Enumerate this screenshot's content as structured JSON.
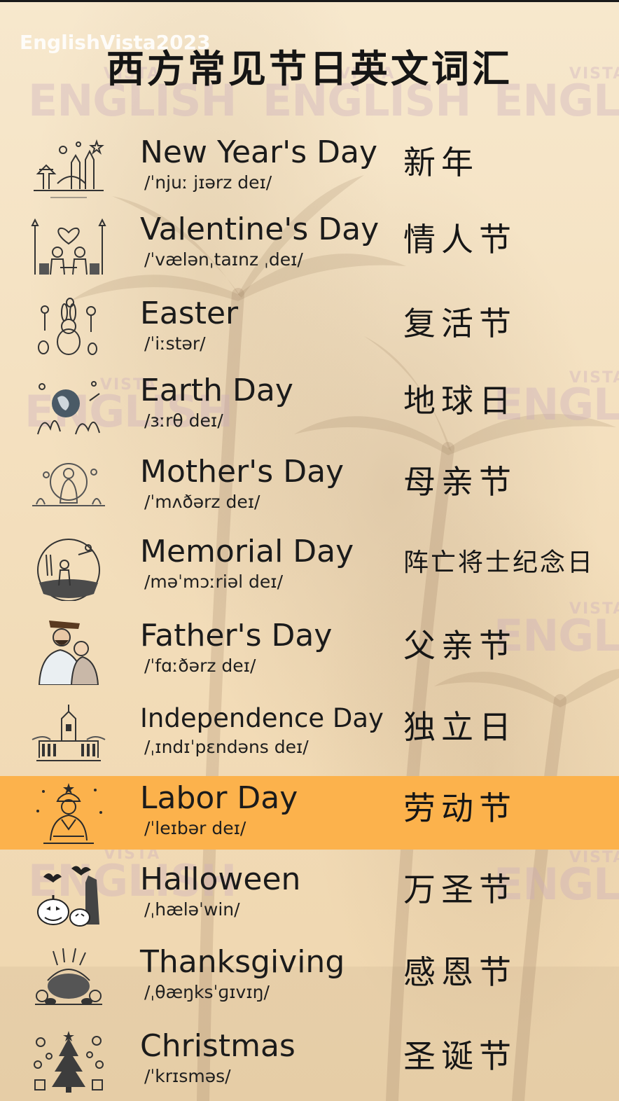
{
  "channel": "EnglishVista2023",
  "title": "西方常见节日英文词汇",
  "watermark": {
    "line1": "VISTA",
    "line2": "ENGLISH"
  },
  "highlight_color": "#fcb24c",
  "items": [
    {
      "icon": "new-year-icon",
      "english": "New Year's Day",
      "ipa": "/ˈnjuː jɪərz deɪ/",
      "chinese": "新年"
    },
    {
      "icon": "valentine-icon",
      "english": "Valentine's Day",
      "ipa": "/ˈvælənˌtaɪnz ˌdeɪ/",
      "chinese": "情人节"
    },
    {
      "icon": "easter-bunny-icon",
      "english": "Easter",
      "ipa": "/ˈiːstər/",
      "chinese": "复活节"
    },
    {
      "icon": "earth-globe-icon",
      "english": "Earth Day",
      "ipa": "/ɜːrθ deɪ/",
      "chinese": "地球日"
    },
    {
      "icon": "mother-child-icon",
      "english": "Mother's Day",
      "ipa": "/ˈmʌðərz deɪ/",
      "chinese": "母亲节"
    },
    {
      "icon": "memorial-soldier-icon",
      "english": "Memorial Day",
      "ipa": "/məˈmɔːriəl deɪ/",
      "chinese": "阵亡将士纪念日"
    },
    {
      "icon": "father-child-icon",
      "english": "Father's Day",
      "ipa": "/ˈfɑːðərz deɪ/",
      "chinese": "父亲节"
    },
    {
      "icon": "independence-hall-icon",
      "english": "Independence Day",
      "ipa": "/ˌɪndɪˈpɛndəns deɪ/",
      "chinese": "独立日"
    },
    {
      "icon": "labor-worker-icon",
      "english": "Labor Day",
      "ipa": "/ˈleɪbər deɪ/",
      "chinese": "劳动节"
    },
    {
      "icon": "pumpkin-bat-icon",
      "english": "Halloween",
      "ipa": "/ˌhæləˈwin/",
      "chinese": "万圣节"
    },
    {
      "icon": "turkey-harvest-icon",
      "english": "Thanksgiving",
      "ipa": "/ˌθæŋksˈɡɪvɪŋ/",
      "chinese": "感恩节"
    },
    {
      "icon": "christmas-tree-icon",
      "english": "Christmas",
      "ipa": "/ˈkrɪsməs/",
      "chinese": "圣诞节"
    }
  ]
}
